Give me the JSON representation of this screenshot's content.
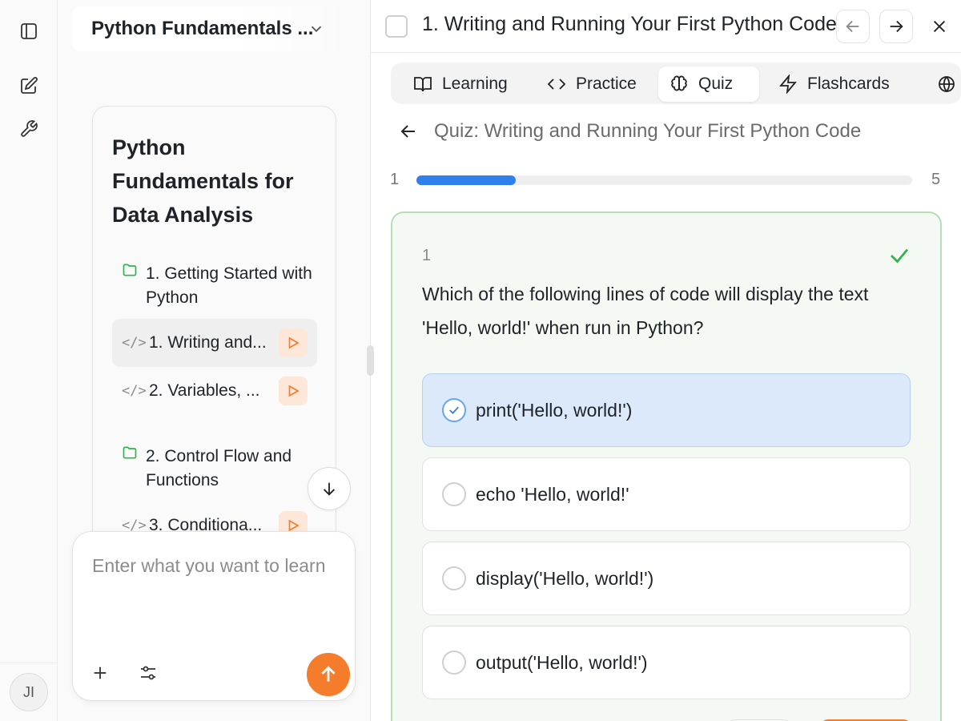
{
  "sidebar_user": {
    "avatar_initials": "JI"
  },
  "course": {
    "header_title": "Python Fundamentals ...",
    "outline_title": "Python Fundamentals for Data Analysis",
    "sections": [
      {
        "label": "1. Getting Started with Python"
      },
      {
        "label": "2. Control Flow and Functions"
      }
    ],
    "lessons": [
      {
        "label": "1. Writing and...",
        "icon": "</>"
      },
      {
        "label": "2. Variables, ...",
        "icon": "</>"
      },
      {
        "label": "3. Conditiona...",
        "icon": "</>"
      }
    ]
  },
  "composer": {
    "placeholder": "Enter what you want to learn"
  },
  "lesson": {
    "title": "1. Writing and Running Your First Python Code"
  },
  "tabs": [
    {
      "label": "Learning"
    },
    {
      "label": "Practice"
    },
    {
      "label": "Quiz"
    },
    {
      "label": "Flashcards"
    }
  ],
  "quiz": {
    "title": "Quiz: Writing and Running Your First Python Code",
    "progress_start": "1",
    "progress_end": "5",
    "progress_fraction": 0.2,
    "question_number": "1",
    "question": "Which of the following lines of code will display the text 'Hello, world!' when run in Python?",
    "options": [
      {
        "text": "print('Hello, world!')",
        "selected": true
      },
      {
        "text": "echo 'Hello, world!'",
        "selected": false
      },
      {
        "text": "display('Hello, world!')",
        "selected": false
      },
      {
        "text": "output('Hello, world!')",
        "selected": false
      }
    ]
  },
  "colors": {
    "accent_orange": "#f47c2a",
    "progress_blue": "#2f7fec",
    "correct_green": "#2fb34d",
    "selected_bg": "#dbe9fb"
  }
}
